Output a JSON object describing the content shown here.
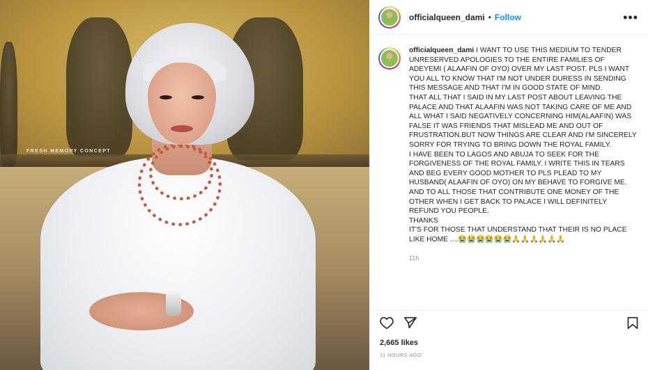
{
  "photo": {
    "watermark": "FRESH MEMORY CONCEPT"
  },
  "header": {
    "username": "officialqueen_dami",
    "separator": "•",
    "follow_label": "Follow",
    "more_icon": "more-icon"
  },
  "caption": {
    "username": "officialqueen_dami",
    "text": "I WANT TO USE THIS MEDIUM TO TENDER UNRESERVED APOLOGIES TO THE ENTIRE FAMILIES OF ADEYEMI ( ALAAFIN OF OYO) OVER MY LAST POST. PLS I WANT YOU ALL TO KNOW THAT I'M NOT UNDER DURESS IN SENDING THIS MESSAGE AND THAT I'M IN GOOD STATE OF MIND.\nTHAT ALL THAT I SAID IN MY LAST POST ABOUT LEAVING THE PALACE AND THAT ALAAFIN WAS NOT TAKING CARE OF ME AND ALL WHAT I SAID NEGATIVELY CONCERNING HIM(ALAAFIN) WAS FALSE IT WAS FRIENDS THAT MISLEAD ME AND OUT OF FRUSTRATION.BUT NOW THINGS ARE CLEAR AND I'M SINCERELY SORRY FOR TRYING TO BRING DOWN THE ROYAL FAMILY.\nI HAVE BEEN TO LAGOS AND ABUJA TO SEEK FOR THE FORGIVENESS OF THE ROYAL FAMILY. I WRITE THIS IN TEARS AND BEG EVERY GOOD MOTHER TO PLS PLEAD TO MY HUSBAND( ALAAFIN OF OYO) ON MY BEHAVE TO FORGIVE ME. AND TO ALL THOSE THAT CONTRIBUTE ONE MONEY OF THE OTHER WHEN I GET BACK TO PALACE I WILL DEFINITELY REFUND YOU PEOPLE.\nTHANKS\nIT'S FOR THOSE THAT UNDERSTAND THAT THEIR IS NO PLACE LIKE HOME ....😭😭😭😭😭😭🙏🙏🙏🙏🙏🙏",
    "time": "11h"
  },
  "actions": {
    "like_icon": "heart-icon",
    "share_icon": "send-icon",
    "save_icon": "bookmark-icon",
    "likes": "2,665 likes",
    "posted_ago": "11 HOURS AGO"
  },
  "colors": {
    "accent": "#0095f6",
    "text": "#262626",
    "muted": "#8e8e8e"
  }
}
